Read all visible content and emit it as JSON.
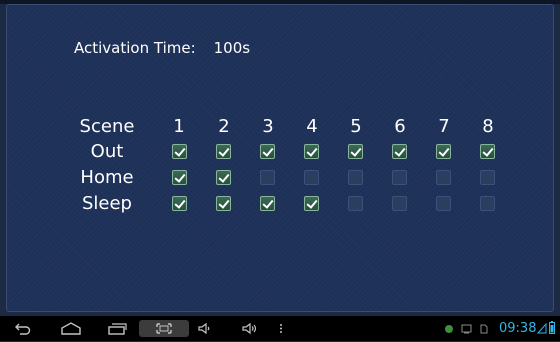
{
  "activation": {
    "label": "Activation Time:",
    "value": "100s"
  },
  "grid": {
    "header_label": "Scene",
    "columns": [
      "1",
      "2",
      "3",
      "4",
      "5",
      "6",
      "7",
      "8"
    ],
    "rows": [
      {
        "label": "Out",
        "checked": [
          true,
          true,
          true,
          true,
          true,
          true,
          true,
          true
        ]
      },
      {
        "label": "Home",
        "checked": [
          true,
          true,
          false,
          false,
          false,
          false,
          false,
          false
        ]
      },
      {
        "label": "Sleep",
        "checked": [
          true,
          true,
          true,
          true,
          false,
          false,
          false,
          false
        ]
      }
    ]
  },
  "navbar": {
    "buttons": [
      "back-icon",
      "home-icon",
      "recent-apps-icon",
      "screenshot-icon",
      "volume-down-icon",
      "volume-up-icon",
      "menu-icon"
    ],
    "status": {
      "time": "09:38",
      "accent_color": "#33b5e5"
    }
  }
}
